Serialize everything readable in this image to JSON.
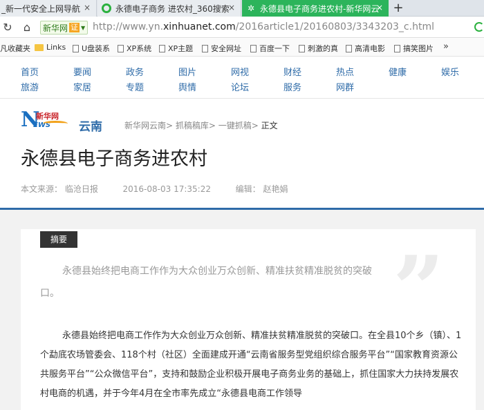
{
  "browser": {
    "tabs": [
      {
        "label": "_新一代安全上网导航",
        "active": false
      },
      {
        "label": "永德电子商务 进农村_360搜索",
        "active": false
      },
      {
        "label": "永德县电子商务进农村-新华网云",
        "active": true
      }
    ],
    "new_tab": "+",
    "close": "×",
    "site_badge": "新华网",
    "cert": "证",
    "url_prefix": "http://www.yn.",
    "url_domain": "xinhuanet.com",
    "url_path": "/2016article1/20160803/3343203_c.html",
    "bookmarks": [
      "凡收藏夹",
      "Links",
      "U盘装系",
      "XP系统",
      "XP主题",
      "安全网址",
      "百度一下",
      "刺激的真",
      "高清电影",
      "搞笑图片"
    ],
    "bookmarks_more": "»"
  },
  "nav": {
    "row1": [
      "首页",
      "要闻",
      "政务",
      "图片",
      "网视",
      "财经",
      "热点",
      "健康",
      "娱乐"
    ],
    "row2": [
      "旅游",
      "家居",
      "专题",
      "舆情",
      "论坛",
      "服务",
      "网群"
    ]
  },
  "logo": {
    "n": "N",
    "brand": "新华网",
    "ews": "EWS",
    "region": "云南"
  },
  "breadcrumb": {
    "path": "新华网云南> 抓稿稿库> 一键抓稿> ",
    "current": "正文"
  },
  "article": {
    "title": "永德县电子商务进农村",
    "source_label": "本文来源：",
    "source": "临沧日报",
    "datetime": "2016-08-03 17:35:22",
    "editor_label": "编辑：",
    "editor": "赵艳娟",
    "abstract_tag": "摘要",
    "quote_mark": "”",
    "abstract": "永德县始终把电商工作作为大众创业万众创新、精准扶贫精准脱贫的突破口。",
    "body": "永德县始终把电商工作作为大众创业万众创新、精准扶贫精准脱贫的突破口。在全县10个乡（镇）、1个勐底农场管委会、118个村（社区）全面建成开通“云南省服务型党组织综合服务平台”“国家教育资源公共服务平台”“公众微信平台”，支持和鼓励企业积极开展电子商务业务的基础上，抓住国家大力扶持发展农村电商的机遇，并于今年4月在全市率先成立“永德县电商工作领导"
  }
}
